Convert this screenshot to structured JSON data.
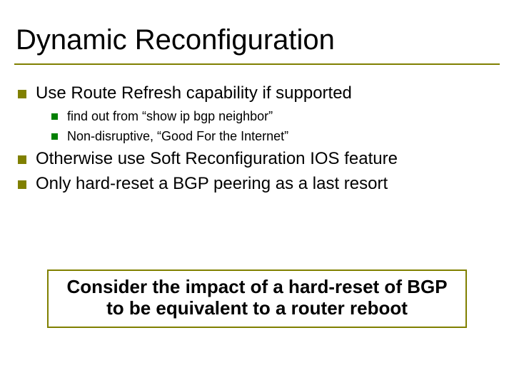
{
  "title": "Dynamic Reconfiguration",
  "bullets": {
    "b1": "Use Route Refresh capability if supported",
    "b1a": "find out from “show ip bgp neighbor”",
    "b1b": "Non-disruptive, “Good For the Internet”",
    "b2": "Otherwise use Soft Reconfiguration IOS feature",
    "b3": "Only hard-reset a BGP peering as a last resort"
  },
  "callout": "Consider the impact of a hard-reset of BGP to be equivalent to a router reboot"
}
